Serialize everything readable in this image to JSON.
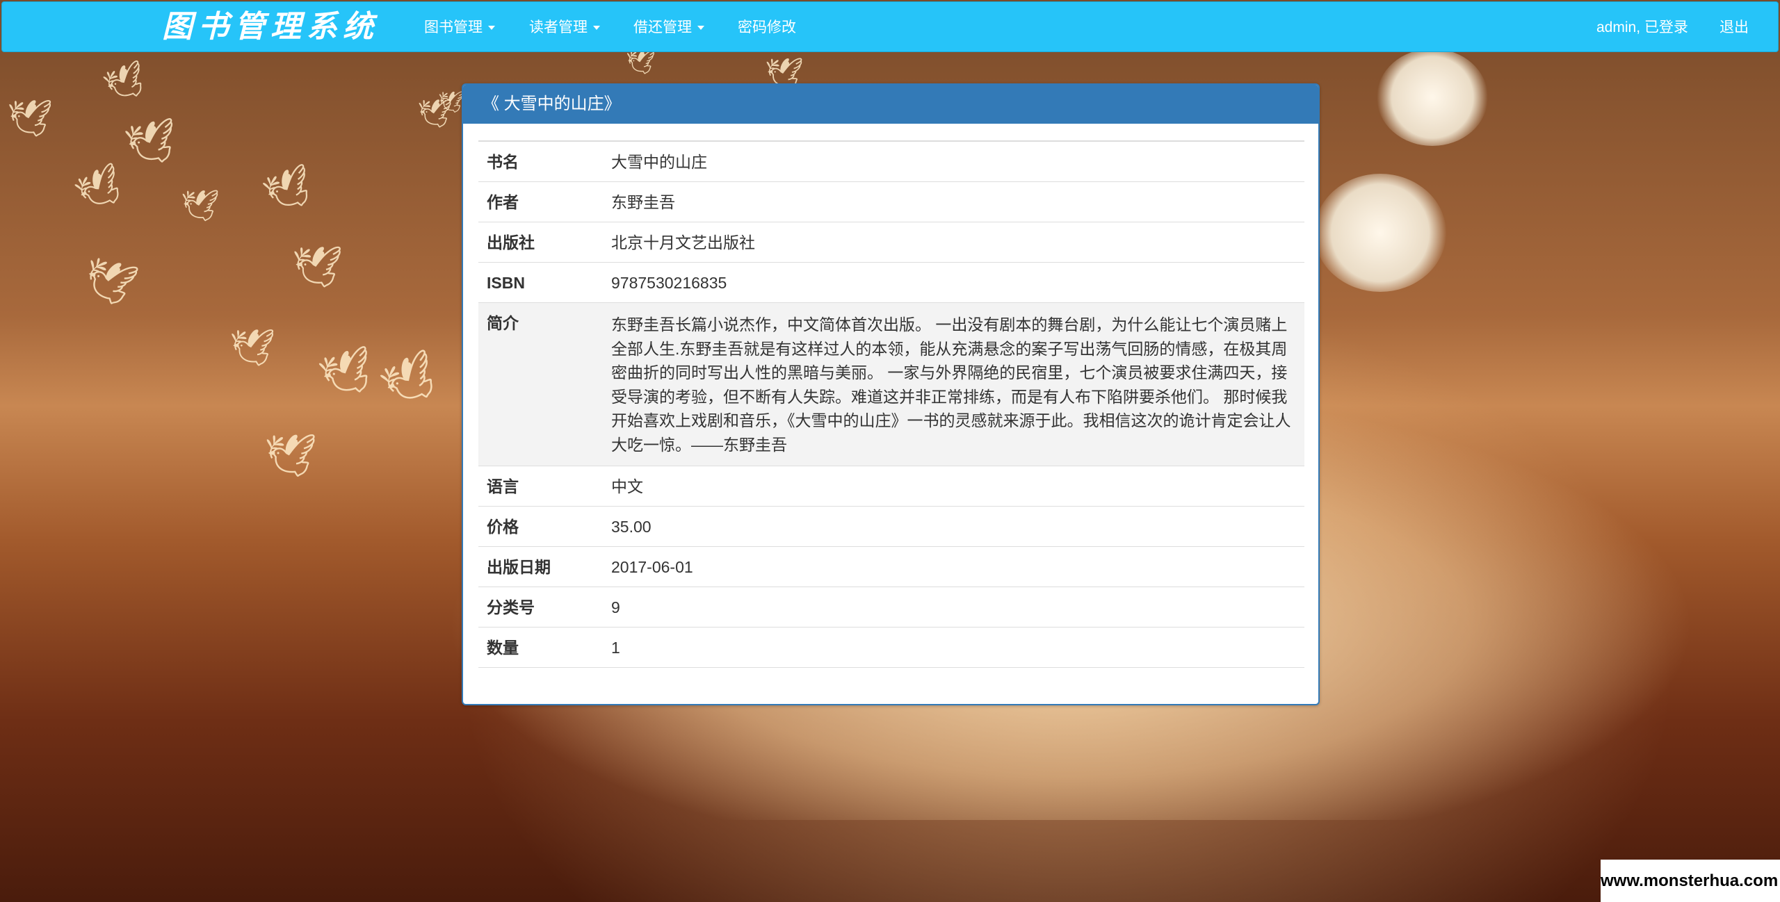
{
  "navbar": {
    "brand": "图书管理系统",
    "menus": [
      {
        "label": "图书管理",
        "has_dropdown": true
      },
      {
        "label": "读者管理",
        "has_dropdown": true
      },
      {
        "label": "借还管理",
        "has_dropdown": true
      },
      {
        "label": "密码修改",
        "has_dropdown": false
      }
    ],
    "user_status": "admin, 已登录",
    "logout": "退出",
    "color": "#26c4f9"
  },
  "panel": {
    "title": "《 大雪中的山庄》",
    "header_color": "#337ab7",
    "rows": [
      {
        "label": "书名",
        "value": "大雪中的山庄"
      },
      {
        "label": "作者",
        "value": "东野圭吾"
      },
      {
        "label": "出版社",
        "value": "北京十月文艺出版社"
      },
      {
        "label": "ISBN",
        "value": "9787530216835"
      },
      {
        "label": "简介",
        "value": "东野圭吾长篇小说杰作，中文简体首次出版。 一出没有剧本的舞台剧，为什么能让七个演员赌上全部人生.东野圭吾就是有这样过人的本领，能从充满悬念的案子写出荡气回肠的情感，在极其周密曲折的同时写出人性的黑暗与美丽。 一家与外界隔绝的民宿里，七个演员被要求住满四天，接受导演的考验，但不断有人失踪。难道这并非正常排练，而是有人布下陷阱要杀他们。 那时候我开始喜欢上戏剧和音乐，《大雪中的山庄》一书的灵感就来源于此。我相信这次的诡计肯定会让人大吃一惊。——东野圭吾"
      },
      {
        "label": "语言",
        "value": "中文"
      },
      {
        "label": "价格",
        "value": "35.00"
      },
      {
        "label": "出版日期",
        "value": "2017-06-01"
      },
      {
        "label": "分类号",
        "value": "9"
      },
      {
        "label": "数量",
        "value": "1"
      }
    ]
  },
  "watermark": "www.monsterhua.com"
}
